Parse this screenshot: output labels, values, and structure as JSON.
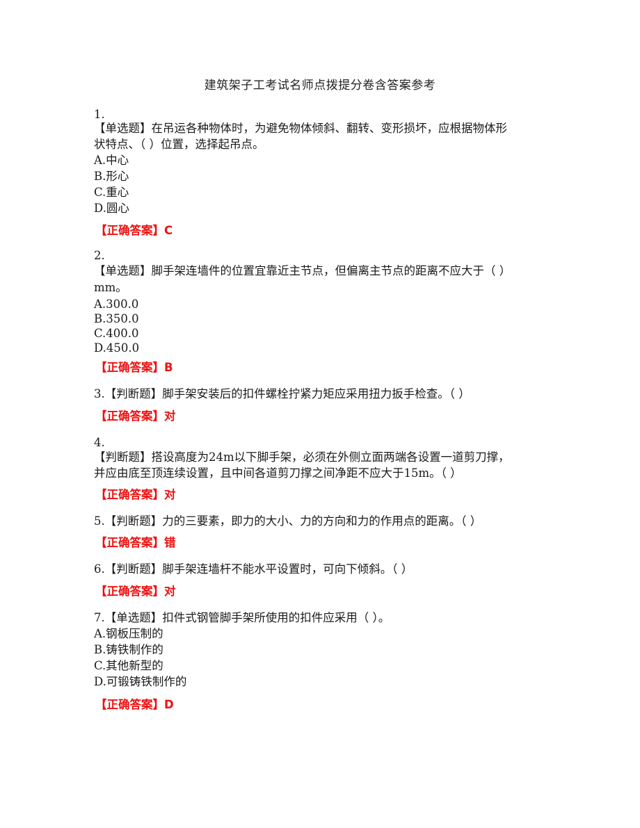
{
  "document": {
    "title": "建筑架子工考试名师点拨提分卷含答案参考"
  },
  "answer_label": "【正确答案】",
  "questions": [
    {
      "number": "1.",
      "type": "【单选题】",
      "text_lines": [
        "在吊运各种物体时，为避免物体倾斜、翻转、变形损坏，应根据物体形",
        "状特点、（ ）位置，选择起吊点。"
      ],
      "options": [
        "A.中心",
        "B.形心",
        "C.重心",
        "D.圆心"
      ],
      "answer": "C"
    },
    {
      "number": "2.",
      "type": "【单选题】",
      "text_lines": [
        "脚手架连墙件的位置宜靠近主节点，但偏离主节点的距离不应大于（ ）",
        "mm。"
      ],
      "options": [
        "A.300.0",
        "B.350.0",
        "C.400.0",
        "D.450.0"
      ],
      "answer": "B"
    },
    {
      "number": "3.",
      "type": "【判断题】",
      "text_lines": [
        "脚手架安装后的扣件螺栓拧紧力矩应采用扭力扳手检查。（ ）"
      ],
      "options": [],
      "answer": "对"
    },
    {
      "number": "4.",
      "type": "【判断题】",
      "text_lines": [
        "搭设高度为24m以下脚手架，必须在外侧立面两端各设置一道剪刀撑，",
        "并应由底至顶连续设置，且中间各道剪刀撑之间净距不应大于15m。（ ）"
      ],
      "options": [],
      "answer": "对"
    },
    {
      "number": "5.",
      "type": "【判断题】",
      "text_lines": [
        "力的三要素，即力的大小、力的方向和力的作用点的距离。（ ）"
      ],
      "options": [],
      "answer": "错"
    },
    {
      "number": "6.",
      "type": "【判断题】",
      "text_lines": [
        "脚手架连墙杆不能水平设置时，可向下倾斜。（ ）"
      ],
      "options": [],
      "answer": "对"
    },
    {
      "number": "7.",
      "type": "【单选题】",
      "text_lines": [
        "扣件式钢管脚手架所使用的扣件应采用（ ）。"
      ],
      "options": [
        "A.钢板压制的",
        "B.铸铁制作的",
        "C.其他新型的",
        "D.可锻铸铁制作的"
      ],
      "answer": "D"
    }
  ]
}
